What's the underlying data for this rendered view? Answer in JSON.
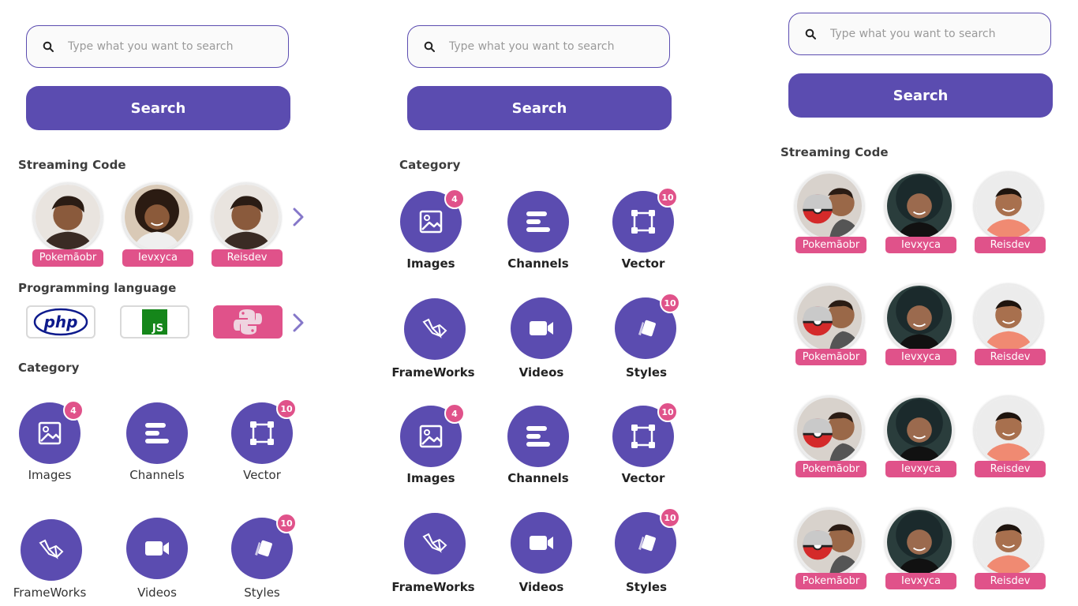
{
  "search": {
    "placeholder": "Type what you want to search",
    "button_label": "Search"
  },
  "sections": {
    "streaming_code": "Streaming Code",
    "programming_language": "Programming language",
    "category": "Category"
  },
  "streamers_panel1": [
    "Pokemãobr",
    "Ievxyca",
    "Reisdev"
  ],
  "streamers_panel3": [
    "Pokemãobr",
    "Ievxyca",
    "Reisdev"
  ],
  "languages": [
    {
      "name": "php-icon",
      "label": "php"
    },
    {
      "name": "js-icon",
      "label": "JS"
    },
    {
      "name": "python-icon",
      "label": ""
    }
  ],
  "categories": {
    "images": {
      "label": "Images",
      "badge": "4"
    },
    "channels": {
      "label": "Channels",
      "badge": ""
    },
    "vector": {
      "label": "Vector",
      "badge": "10"
    },
    "frameworks": {
      "label": "FrameWorks",
      "badge": ""
    },
    "videos": {
      "label": "Videos",
      "badge": ""
    },
    "styles": {
      "label": "Styles",
      "badge": "10"
    }
  },
  "colors": {
    "primary": "#5b4cb0",
    "accent": "#e0528a",
    "text": "#333333"
  }
}
